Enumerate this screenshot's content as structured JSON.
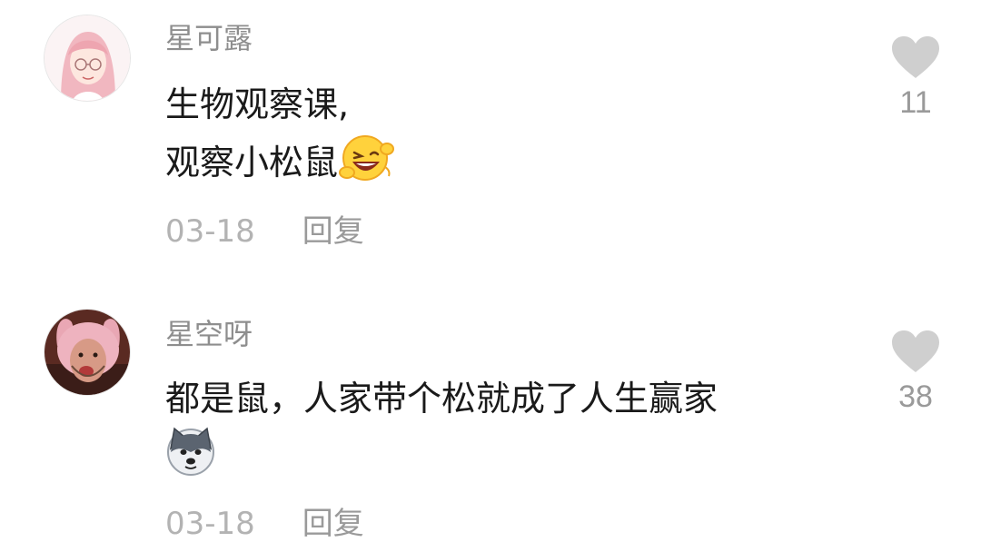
{
  "comments": [
    {
      "username": "星可露",
      "lines": [
        "生物观察课,",
        "观察小松鼠"
      ],
      "emoji": "grin-wink-emoji",
      "date": "03-18",
      "reply_label": "回复",
      "likes": "11"
    },
    {
      "username": "星空呀",
      "lines": [
        "都是鼠，人家带个松就成了人生赢家"
      ],
      "emoji": "husky-dog-emoji",
      "date": "03-18",
      "reply_label": "回复",
      "likes": "38"
    }
  ],
  "colors": {
    "username": "#8e8e8e",
    "text": "#1a1a1a",
    "meta": "#b3b3b3",
    "heart": "#cfcfcf"
  }
}
